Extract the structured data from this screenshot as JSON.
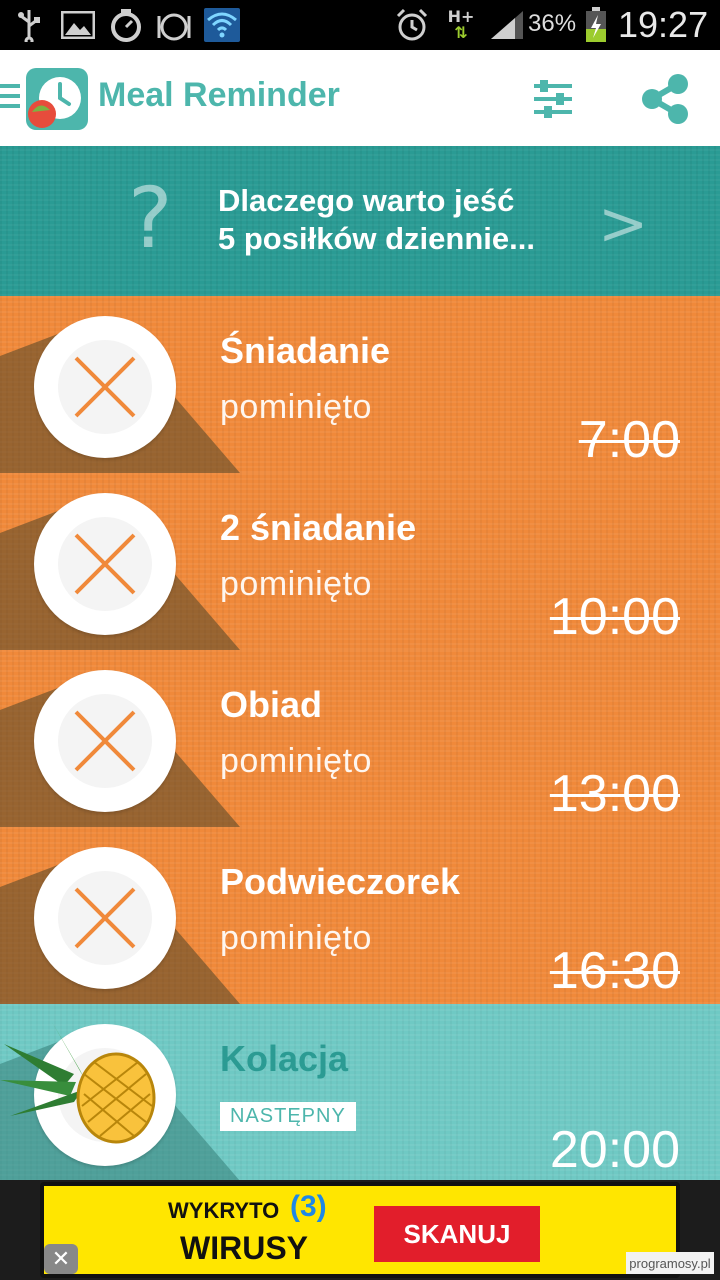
{
  "status_bar": {
    "battery_percent": "36%",
    "time": "19:27",
    "network": "H+",
    "icons": [
      "usb-icon",
      "image-icon",
      "timer-icon",
      "meal-alarm-icon",
      "wifi-icon",
      "alarm-icon",
      "mobile-data-icon",
      "signal-icon",
      "battery-charging-icon"
    ]
  },
  "app_bar": {
    "title": "Meal Reminder",
    "icons": [
      "menu-icon",
      "app-logo-icon",
      "settings-sliders-icon",
      "share-icon"
    ]
  },
  "banner": {
    "line1": "Dlaczego warto jeść",
    "line2": "5 posiłków dziennie...",
    "question_mark": "?",
    "arrow": ">"
  },
  "meals": [
    {
      "name": "Śniadanie",
      "status": "pominięto",
      "time": "7:00",
      "state": "skipped"
    },
    {
      "name": "2 śniadanie",
      "status": "pominięto",
      "time": "10:00",
      "state": "skipped"
    },
    {
      "name": "Obiad",
      "status": "pominięto",
      "time": "13:00",
      "state": "skipped"
    },
    {
      "name": "Podwieczorek",
      "status": "pominięto",
      "time": "16:30",
      "state": "skipped"
    },
    {
      "name": "Kolacja",
      "badge": "NASTĘPNY",
      "time": "20:00",
      "state": "next"
    }
  ],
  "ad": {
    "line1": "WYKRYTO",
    "count": "(3)",
    "line2": "WIRUSY",
    "button": "SKANUJ",
    "close": "✕"
  },
  "watermark": "programosy.pl",
  "colors": {
    "accent": "#4db6ac",
    "banner": "#2a9b94",
    "skipped_row": "#f0893a",
    "next_row": "#6fc9c4",
    "ad_yellow": "#ffe600",
    "ad_button": "#e21e2b"
  }
}
